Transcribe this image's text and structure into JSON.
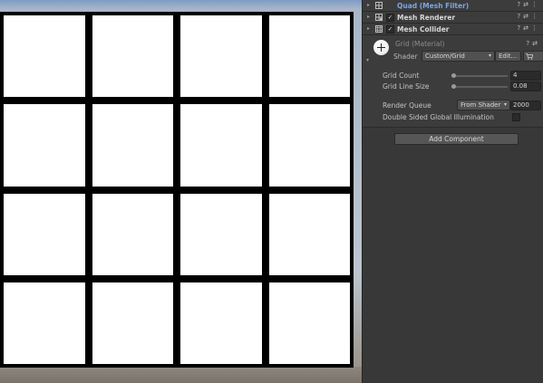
{
  "components": [
    {
      "title": "Quad (Mesh Filter)",
      "has_checkbox": false,
      "checked": false,
      "title_color": "#7ba7e6"
    },
    {
      "title": "Mesh Renderer",
      "has_checkbox": true,
      "checked": true,
      "title_color": "#d6d6d6"
    },
    {
      "title": "Mesh Collider",
      "has_checkbox": true,
      "checked": true,
      "title_color": "#d6d6d6"
    }
  ],
  "icons": {
    "foldout": "▸",
    "check": "✓",
    "help": "?",
    "settings": "⇄",
    "more": "⋮",
    "dropdown": "▾"
  },
  "material": {
    "name": "Grid (Material)",
    "shader_label": "Shader",
    "shader_value": "Custom/Grid",
    "edit_label": "Edit...",
    "properties": [
      {
        "label": "Grid Count",
        "value": "4",
        "slider_fraction": 0.0
      },
      {
        "label": "Grid Line Size",
        "value": "0.08",
        "slider_fraction": 0.0
      }
    ],
    "render_queue_label": "Render Queue",
    "render_queue_mode": "From Shader",
    "render_queue_value": "2000",
    "double_sided_label": "Double Sided Global Illumination",
    "double_sided_checked": false
  },
  "add_component_label": "Add Component",
  "scene": {
    "grid_rows": 4,
    "grid_cols": 4,
    "line_color": "#000000",
    "cell_color": "#ffffff"
  }
}
